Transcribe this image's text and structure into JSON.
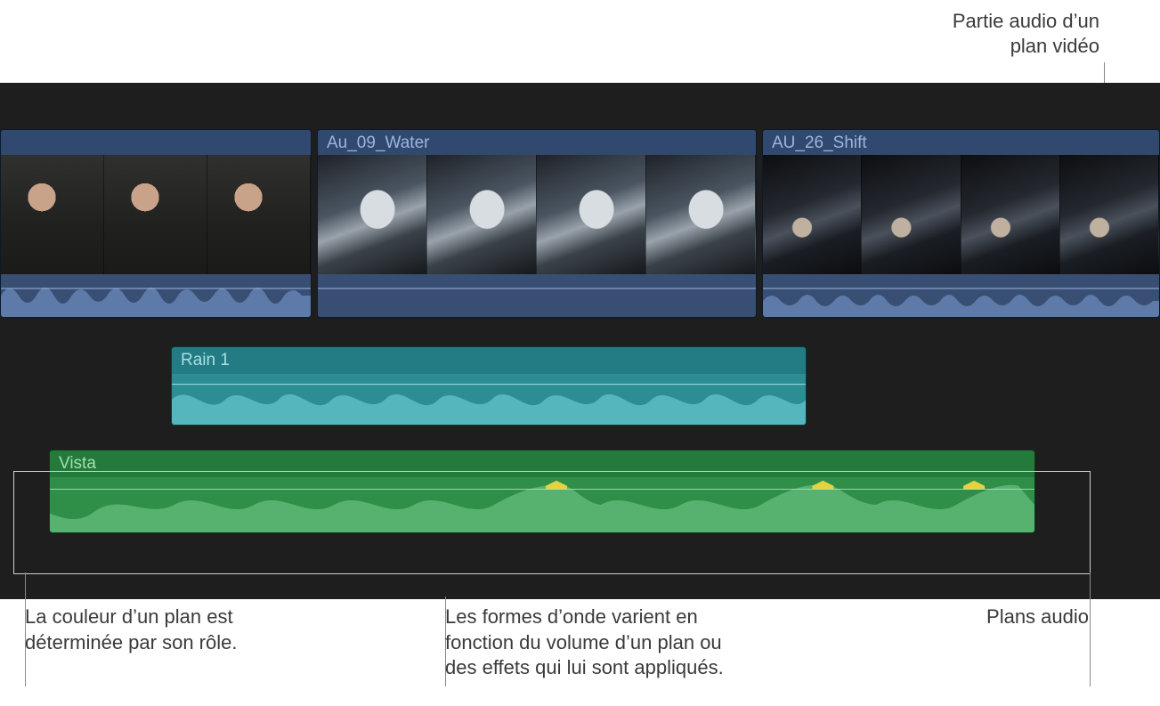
{
  "annotations": {
    "top_right": {
      "line1": "Partie audio d’un",
      "line2": "plan vidéo"
    },
    "bottom_left": {
      "line1": "La couleur d’un plan est",
      "line2": "déterminée par son rôle."
    },
    "bottom_mid": {
      "line1": "Les formes d’onde varient en",
      "line2": "fonction du volume d’un plan ou",
      "line3": "des effets qui lui sont appliqués."
    },
    "bottom_right": {
      "line1": "Plans audio"
    }
  },
  "clips": {
    "video": [
      {
        "name": "",
        "style": "person"
      },
      {
        "name": "Au_09_Water",
        "style": "car"
      },
      {
        "name": "AU_26_Shift",
        "style": "dash"
      }
    ],
    "audio": [
      {
        "name": "Rain 1",
        "role_color": "#2c8d95"
      },
      {
        "name": "Vista",
        "role_color": "#2f8f48"
      }
    ]
  },
  "colors": {
    "video_clip_bg": "#2d4267",
    "video_audio_bg": "#394e73",
    "rain_bg": "#2c8d95",
    "vista_bg": "#2f8f48",
    "timeline_bg": "#1e1e1e"
  }
}
